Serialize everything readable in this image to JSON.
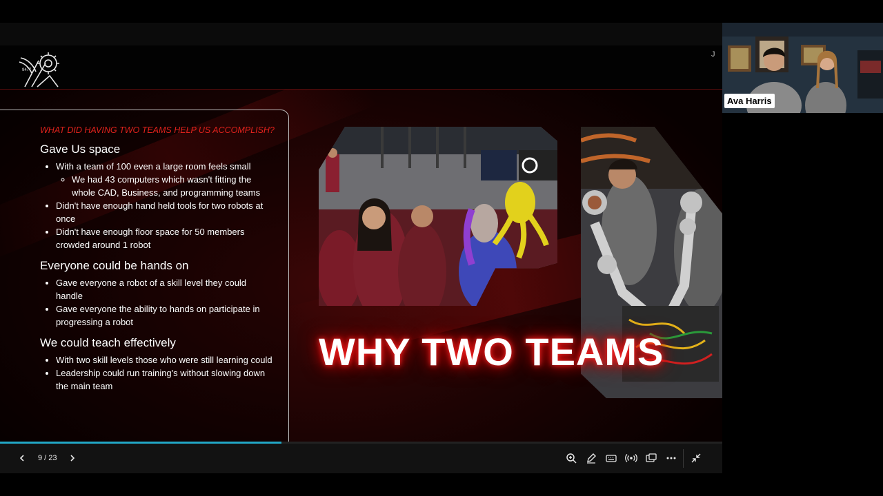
{
  "slide": {
    "marker": "J",
    "question": "WHAT DID HAVING TWO TEAMS HELP US ACCOMPLISH?",
    "sections": [
      {
        "heading": "Gave Us space",
        "bullets": [
          "With a team of 100 even a large room feels small",
          "Didn't have enough hand held tools for two robots at once",
          "Didn't have enough floor space for 50 members crowded around 1 robot"
        ],
        "sub_bullet": "We had 43 computers which wasn't fitting the whole CAD, Business, and programming teams"
      },
      {
        "heading": "Everyone could be hands on",
        "bullets": [
          "Gave everyone a robot of a skill level they could handle",
          "Gave everyone the ability to hands on participate in progressing a robot"
        ]
      },
      {
        "heading": "We could teach effectively",
        "bullets": [
          "With two skill levels those who were still learning could",
          "Leadership could run training's without slowing down the main team"
        ]
      }
    ],
    "headline": "WHY TWO TEAMS",
    "logo_text": "9477"
  },
  "controls": {
    "counter": "9 / 23",
    "progress_fraction": 0.39
  },
  "participant": {
    "name": "Ava Harris"
  },
  "colors": {
    "accent_red": "#e0221c",
    "progress": "#22a8c7"
  }
}
